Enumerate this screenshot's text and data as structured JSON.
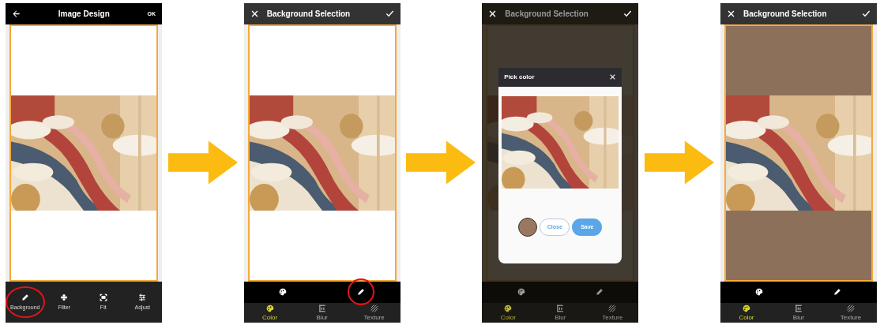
{
  "screens": [
    {
      "kind": "tools",
      "dimmed": false,
      "header": {
        "title": "Image Design",
        "leading": {
          "kind": "back"
        },
        "trailing": {
          "kind": "text",
          "label": "OK"
        }
      },
      "canvas": {
        "color": "#ffffff"
      },
      "tools": [
        {
          "kind": "pen",
          "label": "Background",
          "highlighted": true
        },
        {
          "kind": "filter",
          "label": "Filter",
          "highlighted": false
        },
        {
          "kind": "fit",
          "label": "Fit",
          "highlighted": false
        },
        {
          "kind": "adjust",
          "label": "Adjust",
          "highlighted": false
        }
      ]
    },
    {
      "kind": "background",
      "dimmed": false,
      "header": {
        "title": "Background Selection",
        "leading": {
          "kind": "close"
        },
        "trailing": {
          "kind": "check"
        }
      },
      "canvas": {
        "color": "#ffffff"
      },
      "actions": [
        {
          "kind": "palette",
          "highlighted": false
        },
        {
          "kind": "pen",
          "highlighted": true
        }
      ],
      "tabs": [
        {
          "kind": "color",
          "label": "Color",
          "selected": true
        },
        {
          "kind": "blur",
          "label": "Blur",
          "selected": false
        },
        {
          "kind": "texture",
          "label": "Texture",
          "selected": false
        }
      ]
    },
    {
      "kind": "background",
      "dimmed": true,
      "header": {
        "title": "Background Selection",
        "leading": {
          "kind": "close"
        },
        "trailing": {
          "kind": "check"
        }
      },
      "canvas": {
        "color": "#ffffff"
      },
      "actions": [
        {
          "kind": "palette",
          "highlighted": false
        },
        {
          "kind": "pen",
          "highlighted": false
        }
      ],
      "tabs": [
        {
          "kind": "color",
          "label": "Color",
          "selected": true
        },
        {
          "kind": "blur",
          "label": "Blur",
          "selected": false
        },
        {
          "kind": "texture",
          "label": "Texture",
          "selected": false
        }
      ],
      "dialog": {
        "title": "Pick color",
        "swatch": {
          "color": "#9a7860"
        },
        "buttons": [
          {
            "kind": "outline",
            "label": "Close"
          },
          {
            "kind": "filled",
            "label": "Save"
          }
        ]
      }
    },
    {
      "kind": "background",
      "dimmed": false,
      "header": {
        "title": "Background Selection",
        "leading": {
          "kind": "close"
        },
        "trailing": {
          "kind": "check"
        }
      },
      "canvas": {
        "color": "#8c7059"
      },
      "actions": [
        {
          "kind": "palette",
          "highlighted": false
        },
        {
          "kind": "pen",
          "highlighted": false
        }
      ],
      "tabs": [
        {
          "kind": "color",
          "label": "Color",
          "selected": true
        },
        {
          "kind": "blur",
          "label": "Blur",
          "selected": false
        },
        {
          "kind": "texture",
          "label": "Texture",
          "selected": false
        }
      ]
    }
  ]
}
